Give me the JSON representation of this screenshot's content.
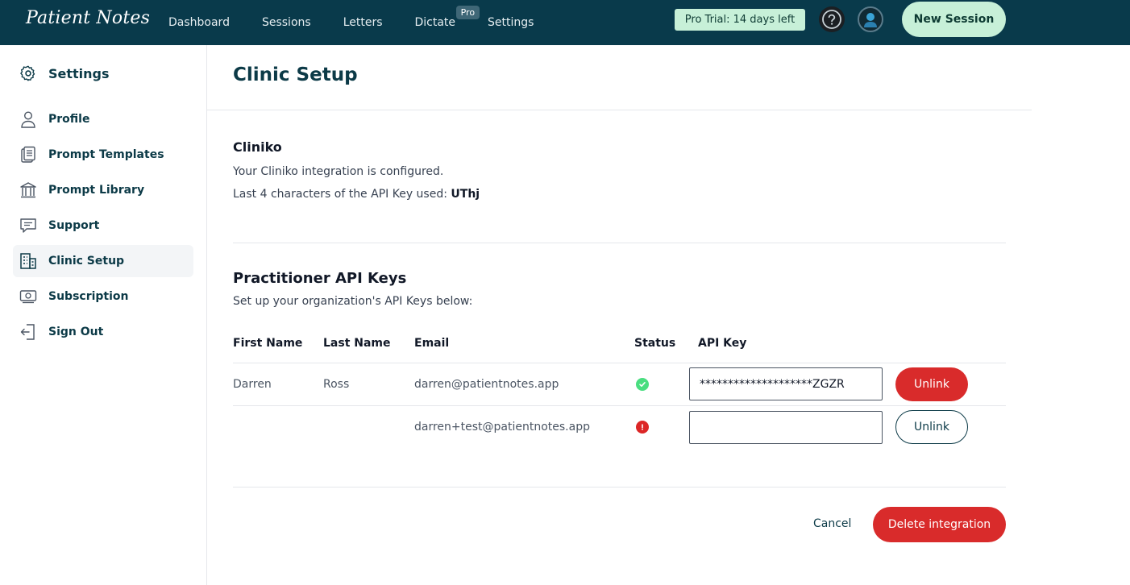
{
  "app": {
    "logo_text": "Patient Notes"
  },
  "nav": {
    "items": [
      {
        "label": "Dashboard"
      },
      {
        "label": "Sessions"
      },
      {
        "label": "Letters"
      },
      {
        "label": "Dictate",
        "badge": "Pro"
      },
      {
        "label": "Settings"
      }
    ],
    "trial_badge": "Pro Trial: 14 days left",
    "help_icon": "question-circle-icon",
    "new_session_label": "New Session"
  },
  "sidebar": {
    "header": "Settings",
    "items": [
      {
        "label": "Profile",
        "icon": "user-icon"
      },
      {
        "label": "Prompt Templates",
        "icon": "clipboard-icon"
      },
      {
        "label": "Prompt Library",
        "icon": "library-icon"
      },
      {
        "label": "Support",
        "icon": "chat-icon"
      },
      {
        "label": "Clinic Setup",
        "icon": "building-icon",
        "active": true
      },
      {
        "label": "Subscription",
        "icon": "money-icon"
      },
      {
        "label": "Sign Out",
        "icon": "sign-out-icon"
      }
    ]
  },
  "main": {
    "title": "Clinic Setup",
    "cliniko": {
      "title": "Cliniko",
      "configured_text": "Your Cliniko integration is configured.",
      "api_key_prefix": "Last 4 characters of the API Key used:",
      "api_key_last4": "UThj"
    },
    "practitioners": {
      "title": "Practitioner API Keys",
      "subtitle": "Set up your organization's API Keys below:",
      "columns": [
        "First Name",
        "Last Name",
        "Email",
        "Status",
        "API Key"
      ],
      "rows": [
        {
          "first_name": "Darren",
          "last_name": "Ross",
          "email": "darren@patientnotes.app",
          "status": "ok",
          "api_key": "********************ZGZR",
          "unlink_label": "Unlink"
        },
        {
          "first_name": "",
          "last_name": "",
          "email": "darren+test@patientnotes.app",
          "status": "error",
          "api_key": "",
          "unlink_label": "Unlink"
        }
      ]
    },
    "actions": {
      "cancel_label": "Cancel",
      "delete_label": "Delete integration"
    }
  },
  "colors": {
    "nav_bg": "#093a4b",
    "accent_green": "#c7f0d8",
    "danger": "#d92b2b",
    "ok": "#4ade80"
  }
}
